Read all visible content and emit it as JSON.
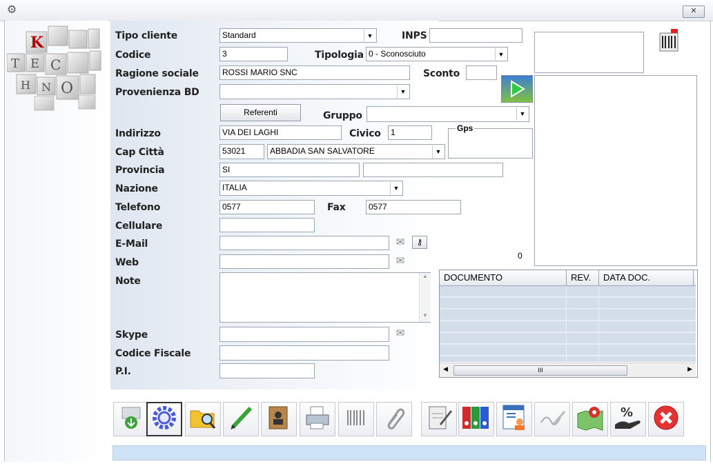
{
  "window": {
    "close_label": "✕"
  },
  "logo": {
    "letters": [
      "K",
      "T",
      "E",
      "C",
      "H",
      "N",
      "O"
    ]
  },
  "form": {
    "tipo_cliente": {
      "label": "Tipo cliente",
      "value": "Standard"
    },
    "inps": {
      "label": "INPS",
      "value": ""
    },
    "codice": {
      "label": "Codice",
      "value": "3"
    },
    "tipologia": {
      "label": "Tipologia",
      "value": "0 - Sconosciuto"
    },
    "ragione_sociale": {
      "label": "Ragione sociale",
      "value": "ROSSI MARIO SNC"
    },
    "sconto": {
      "label": "Sconto",
      "value": ""
    },
    "provenienza": {
      "label": "Provenienza BD",
      "value": ""
    },
    "referenti": {
      "label": "Referenti"
    },
    "gruppo": {
      "label": "Gruppo",
      "value": ""
    },
    "indirizzo": {
      "label": "Indirizzo",
      "value": "VIA DEI LAGHI"
    },
    "civico": {
      "label": "Civico",
      "value": "1"
    },
    "gps": {
      "label": "Gps"
    },
    "cap_citta": {
      "label": "Cap Città",
      "cap": "53021",
      "citta": "ABBADIA SAN SALVATORE"
    },
    "provincia": {
      "label": "Provincia",
      "value": "SI",
      "extra": ""
    },
    "nazione": {
      "label": "Nazione",
      "value": "ITALIA"
    },
    "telefono": {
      "label": "Telefono",
      "value": "0577"
    },
    "fax": {
      "label": "Fax",
      "value": "0577"
    },
    "cellulare": {
      "label": "Cellulare",
      "value": ""
    },
    "email": {
      "label": "E-Mail",
      "value": ""
    },
    "web": {
      "label": "Web",
      "value": ""
    },
    "note": {
      "label": "Note",
      "value": ""
    },
    "skype": {
      "label": "Skype",
      "value": ""
    },
    "codice_fiscale": {
      "label": "Codice Fiscale",
      "value": ""
    },
    "pi": {
      "label": "P.I.",
      "value": ""
    }
  },
  "documents": {
    "count": "0",
    "columns": [
      "DOCUMENTO",
      "REV.",
      "DATA DOC."
    ],
    "scroll_thumb": "III"
  },
  "toolbar": {
    "icons": [
      "download-icon",
      "settings-gear-icon",
      "folder-search-icon",
      "pencil-icon",
      "contacts-book-icon",
      "printer-icon",
      "barcode-icon",
      "paperclip-icon",
      "document-sign-icon",
      "binders-icon",
      "user-card-icon",
      "signature-icon",
      "map-pin-icon",
      "discount-hand-icon",
      "close-circle-icon"
    ]
  },
  "colors": {
    "status_bar": "#cfe3f6",
    "form_gradient": "#dfe6f0",
    "grid_row": "#d4deea"
  }
}
